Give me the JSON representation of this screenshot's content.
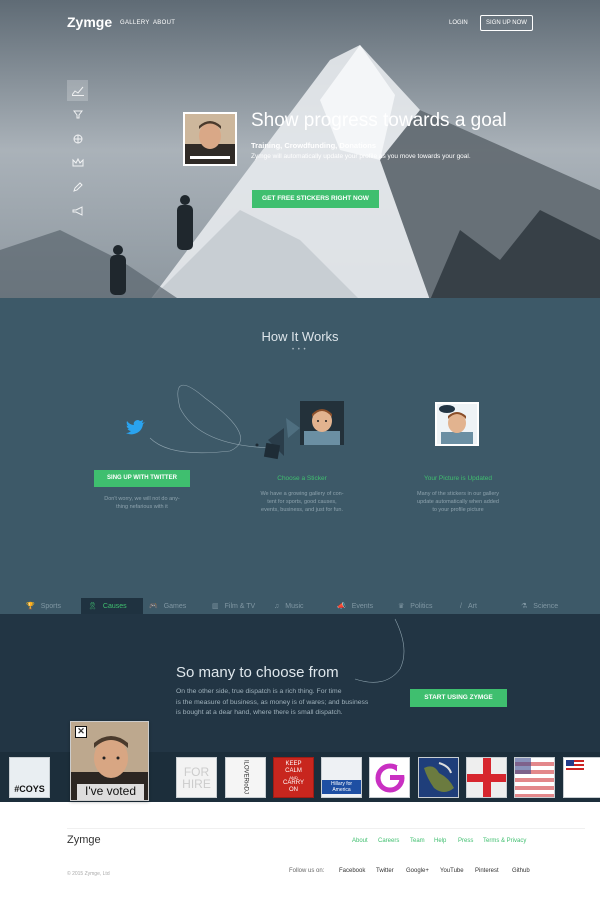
{
  "header": {
    "logo": "Zymge",
    "nav": [
      "GALLERY",
      "ABOUT"
    ],
    "login": "LOGIN",
    "signup": "SIGN UP NOW"
  },
  "hero": {
    "title": "Show progress towards a goal",
    "subtitle": "Training, Crowdfunding, Donations",
    "description": "Zymge will automatically update your profile as you move towards your goal.",
    "cta": "GET FREE STICKERS RIGHT NOW",
    "side_icons": [
      "chart-icon",
      "trophy-icon",
      "globe-icon",
      "crown-icon",
      "pencil-icon",
      "megaphone-icon"
    ]
  },
  "how": {
    "title": "How It Works",
    "dots": "• • •",
    "twitter_button": "SING UP WITH TWITTER",
    "twitter_text": [
      "Don't worry, we will not do any-",
      "thing nefarious with it"
    ],
    "sticker_title": "Choose a Sticker",
    "sticker_text": [
      "We have a growing gallery of con-",
      "tent for sports, good causes,",
      "events, business, and just for fun."
    ],
    "updated_title": "Your Picture is Updated",
    "updated_text": [
      "Many of the stickers in our gallery",
      "update automatically when added",
      "to your profile picture"
    ]
  },
  "tabs": [
    {
      "label": "Sports",
      "icon": "trophy-icon"
    },
    {
      "label": "Causes",
      "icon": "ribbon-icon",
      "active": true
    },
    {
      "label": "Games",
      "icon": "gamepad-icon"
    },
    {
      "label": "Film & TV",
      "icon": "film-icon"
    },
    {
      "label": "Music",
      "icon": "music-icon"
    },
    {
      "label": "Events",
      "icon": "bullhorn-icon"
    },
    {
      "label": "Politics",
      "icon": "crown-icon"
    },
    {
      "label": "Art",
      "icon": "brush-icon"
    },
    {
      "label": "Science",
      "icon": "flask-icon"
    }
  ],
  "choose": {
    "title": "So many to choose from",
    "text": [
      "On the other side, true dispatch is a rich thing. For time",
      "is the measure of business, as money is of wares; and business",
      "is bought at a dear hand, where there is small dispatch."
    ],
    "button": "START USING ZYMGE"
  },
  "stickers": {
    "coys": "#COYS",
    "for_hire": [
      "FOR",
      "HIRE"
    ],
    "keep_calm": [
      "KEEP",
      "CALM",
      "AND",
      "CARRY",
      "ON"
    ],
    "hillary": "Hillary for America",
    "voted": "I've voted"
  },
  "footer": {
    "logo": "Zymge",
    "links": [
      "About",
      "Careers",
      "Team",
      "Help",
      "Press",
      "Terms & Privacy"
    ],
    "copyright": "© 2015 Zymge, Ltd",
    "follow_label": "Follow us on:",
    "social": [
      "Facebook",
      "Twitter",
      "Google+",
      "YouTube",
      "Pinterest",
      "Github"
    ]
  },
  "colors": {
    "accent": "#3fbf6f",
    "section_dark": "#223544",
    "section_mid": "#3d5968"
  }
}
